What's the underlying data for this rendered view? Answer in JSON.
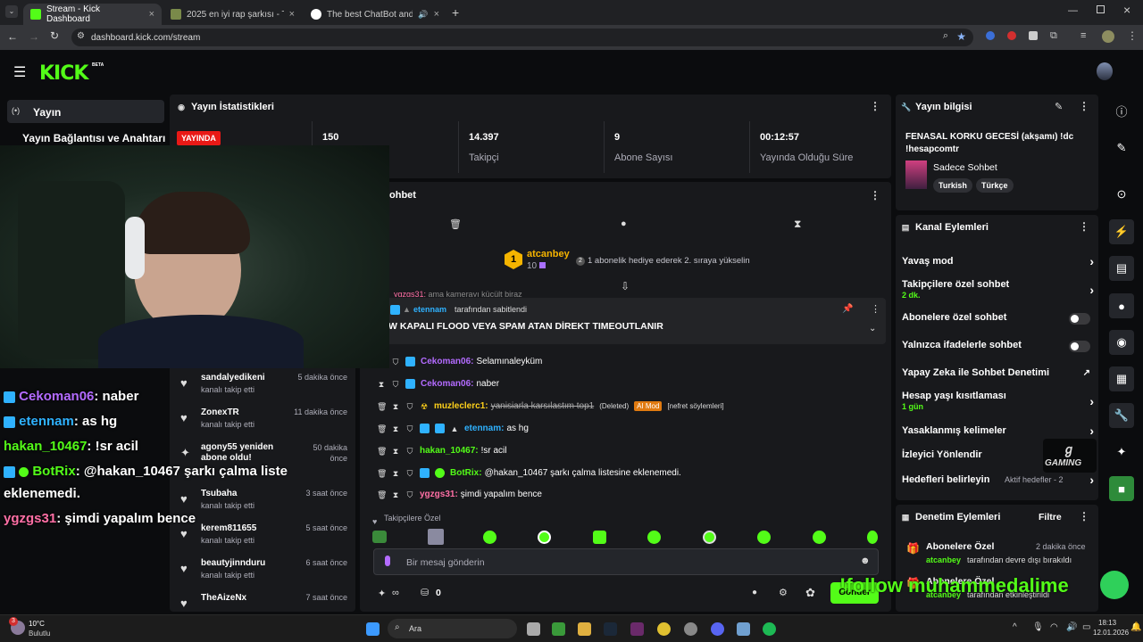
{
  "browser": {
    "tabs": [
      {
        "title": "Stream - Kick Dashboard",
        "close": "×"
      },
      {
        "title": "2025 en iyi rap şarkısı - Tier List",
        "close": "×"
      },
      {
        "title": "The best ChatBot and Widg",
        "close": "×"
      }
    ],
    "new_tab": "+",
    "url": "dashboard.kick.com/stream"
  },
  "kick": {
    "logo": "KICK",
    "beta": "BETA",
    "sidebar": {
      "yayin": "Yayın",
      "baglanti": "Yayın Bağlantısı ve Anahtarı"
    },
    "stats": {
      "title": "Yayın İstatistikleri",
      "live_badge": "YAYINDA",
      "viewers": "150",
      "followers_n": "14.397",
      "followers_l": "Takipçi",
      "subs_n": "9",
      "subs_l": "Abone Sayısı",
      "time_n": "00:12:57",
      "time_l": "Yayında Olduğu Süre"
    },
    "chat": {
      "title": "ohbet",
      "gift_user": "atcanbey",
      "gift_count": "10",
      "gift_text": "1 abonelik hediye ederek 2. sıraya yükselin",
      "faded_line": "ama kamerayı küçült biraz",
      "faded_user": "ygzgs31:",
      "pinned_by": "etennam",
      "pinned_suffix": "tarafından sabitlendi",
      "pinned_msg": "W KAPALI FLOOD VEYA SPAM ATAN DİREKT TIMEOUTLANIR",
      "messages": [
        {
          "user": "Cekoman06:",
          "text": "Selamınaleyküm",
          "color": "#b36bff"
        },
        {
          "user": "Cekoman06:",
          "text": "naber",
          "color": "#b36bff"
        },
        {
          "user": "muzleclerc1:",
          "text": "yanisiarla karsılastım top1",
          "color": "#ffd11a",
          "deleted": "(Deleted)",
          "mod": "AI Mod",
          "reason": "[nefret söylemleri]"
        },
        {
          "user": "etennam:",
          "text": "as hg",
          "color": "#2fb2ff"
        },
        {
          "user": "hakan_10467:",
          "text": "!sr acil",
          "color": "#53fc18"
        },
        {
          "user": "BotRix:",
          "text": "@hakan_10467 şarkı çalma listesine eklenemedi.",
          "color": "#53fc18"
        },
        {
          "user": "ygzgs31:",
          "text": "şimdi yapalım bence",
          "color": "#ff6fa5"
        }
      ],
      "followers_only": "Takipçilere Özel",
      "input_placeholder": "Bir mesaj gönderin",
      "points": "0",
      "send": "Gönder"
    },
    "feed": [
      {
        "name": "sandalyedikeni",
        "sub": "kanalı takip etti",
        "time": "5 dakika önce"
      },
      {
        "name": "ZonexTR",
        "sub": "kanalı takip etti",
        "time": "11 dakika önce"
      },
      {
        "name": "agony55 yeniden abone oldu!",
        "sub": "",
        "time": "50 dakika önce"
      },
      {
        "name": "Tsubaha",
        "sub": "kanalı takip etti",
        "time": "3 saat önce"
      },
      {
        "name": "kerem811655",
        "sub": "kanalı takip etti",
        "time": "5 saat önce"
      },
      {
        "name": "beautyjinnduru",
        "sub": "kanalı takip etti",
        "time": "6 saat önce"
      },
      {
        "name": "TheAizeNx",
        "sub": "",
        "time": "7 saat önce"
      }
    ],
    "info": {
      "title": "Yayın bilgisi",
      "stream_title": "FENASAL KORKU GECESİ (akşamı) !dc !hesapcomtr",
      "category": "Sadece Sohbet",
      "tags": [
        "Turkish",
        "Türkçe"
      ]
    },
    "actions": {
      "title": "Kanal Eylemleri",
      "items": [
        {
          "label": "Yavaş mod",
          "kind": "chevron"
        },
        {
          "label": "Takipçilere özel sohbet",
          "sub": "2 dk.",
          "kind": "chevron"
        },
        {
          "label": "Abonelere özel sohbet",
          "kind": "toggle"
        },
        {
          "label": "Yalnızca ifadelerle sohbet",
          "kind": "toggle"
        },
        {
          "label": "Yapay Zeka ile Sohbet Denetimi",
          "kind": "external"
        },
        {
          "label": "Hesap yaşı kısıtlaması",
          "sub": "1 gün",
          "kind": "chevron"
        },
        {
          "label": "Yasaklanmış kelimeler",
          "kind": "chevron"
        },
        {
          "label": "İzleyici Yönlendir",
          "kind": "none"
        },
        {
          "label": "Hedefleri belirleyin",
          "extra": "Aktif hedefler - 2",
          "kind": "chevron"
        }
      ]
    },
    "moderation": {
      "title": "Denetim Eylemleri",
      "filter": "Filtre",
      "items": [
        {
          "title": "Abonelere Özel",
          "time": "2 dakika önce",
          "user": "atcanbey",
          "text": "tarafından devre dışı bırakıldı"
        },
        {
          "title": "Abonelere Özel",
          "time": "",
          "user": "atcanbey",
          "text": "tarafından etkinleştirildi"
        }
      ]
    }
  },
  "overlay": {
    "lines": [
      {
        "user": "Cekoman06",
        "text": ": naber",
        "color": "#b36bff"
      },
      {
        "user": "etennam",
        "text": ": as hg",
        "color": "#2fb2ff"
      },
      {
        "user": "hakan_10467",
        "text": ": !sr acil",
        "color": "#53fc18"
      },
      {
        "user": "BotRix",
        "text": ": @hakan_10467 şarkı çalma liste",
        "color": "#53fc18"
      },
      {
        "user": "",
        "text": "eklenemedi.",
        "color": "#fff"
      },
      {
        "user": "ygzgs31",
        "text": ": şimdi yapalım bence",
        "color": "#ff6fa5"
      }
    ],
    "follow_text": "!follow muhammedalime",
    "gaming_label": "GAMING"
  },
  "taskbar": {
    "weather_temp": "10°C",
    "weather_desc": "Bulutlu",
    "weather_badge": "3",
    "search": "Ara",
    "time": "18:13",
    "date": "12.01.2026"
  },
  "colors": {
    "kick_green": "#53fc18",
    "live_red": "#e91916",
    "panel": "#18191c"
  }
}
